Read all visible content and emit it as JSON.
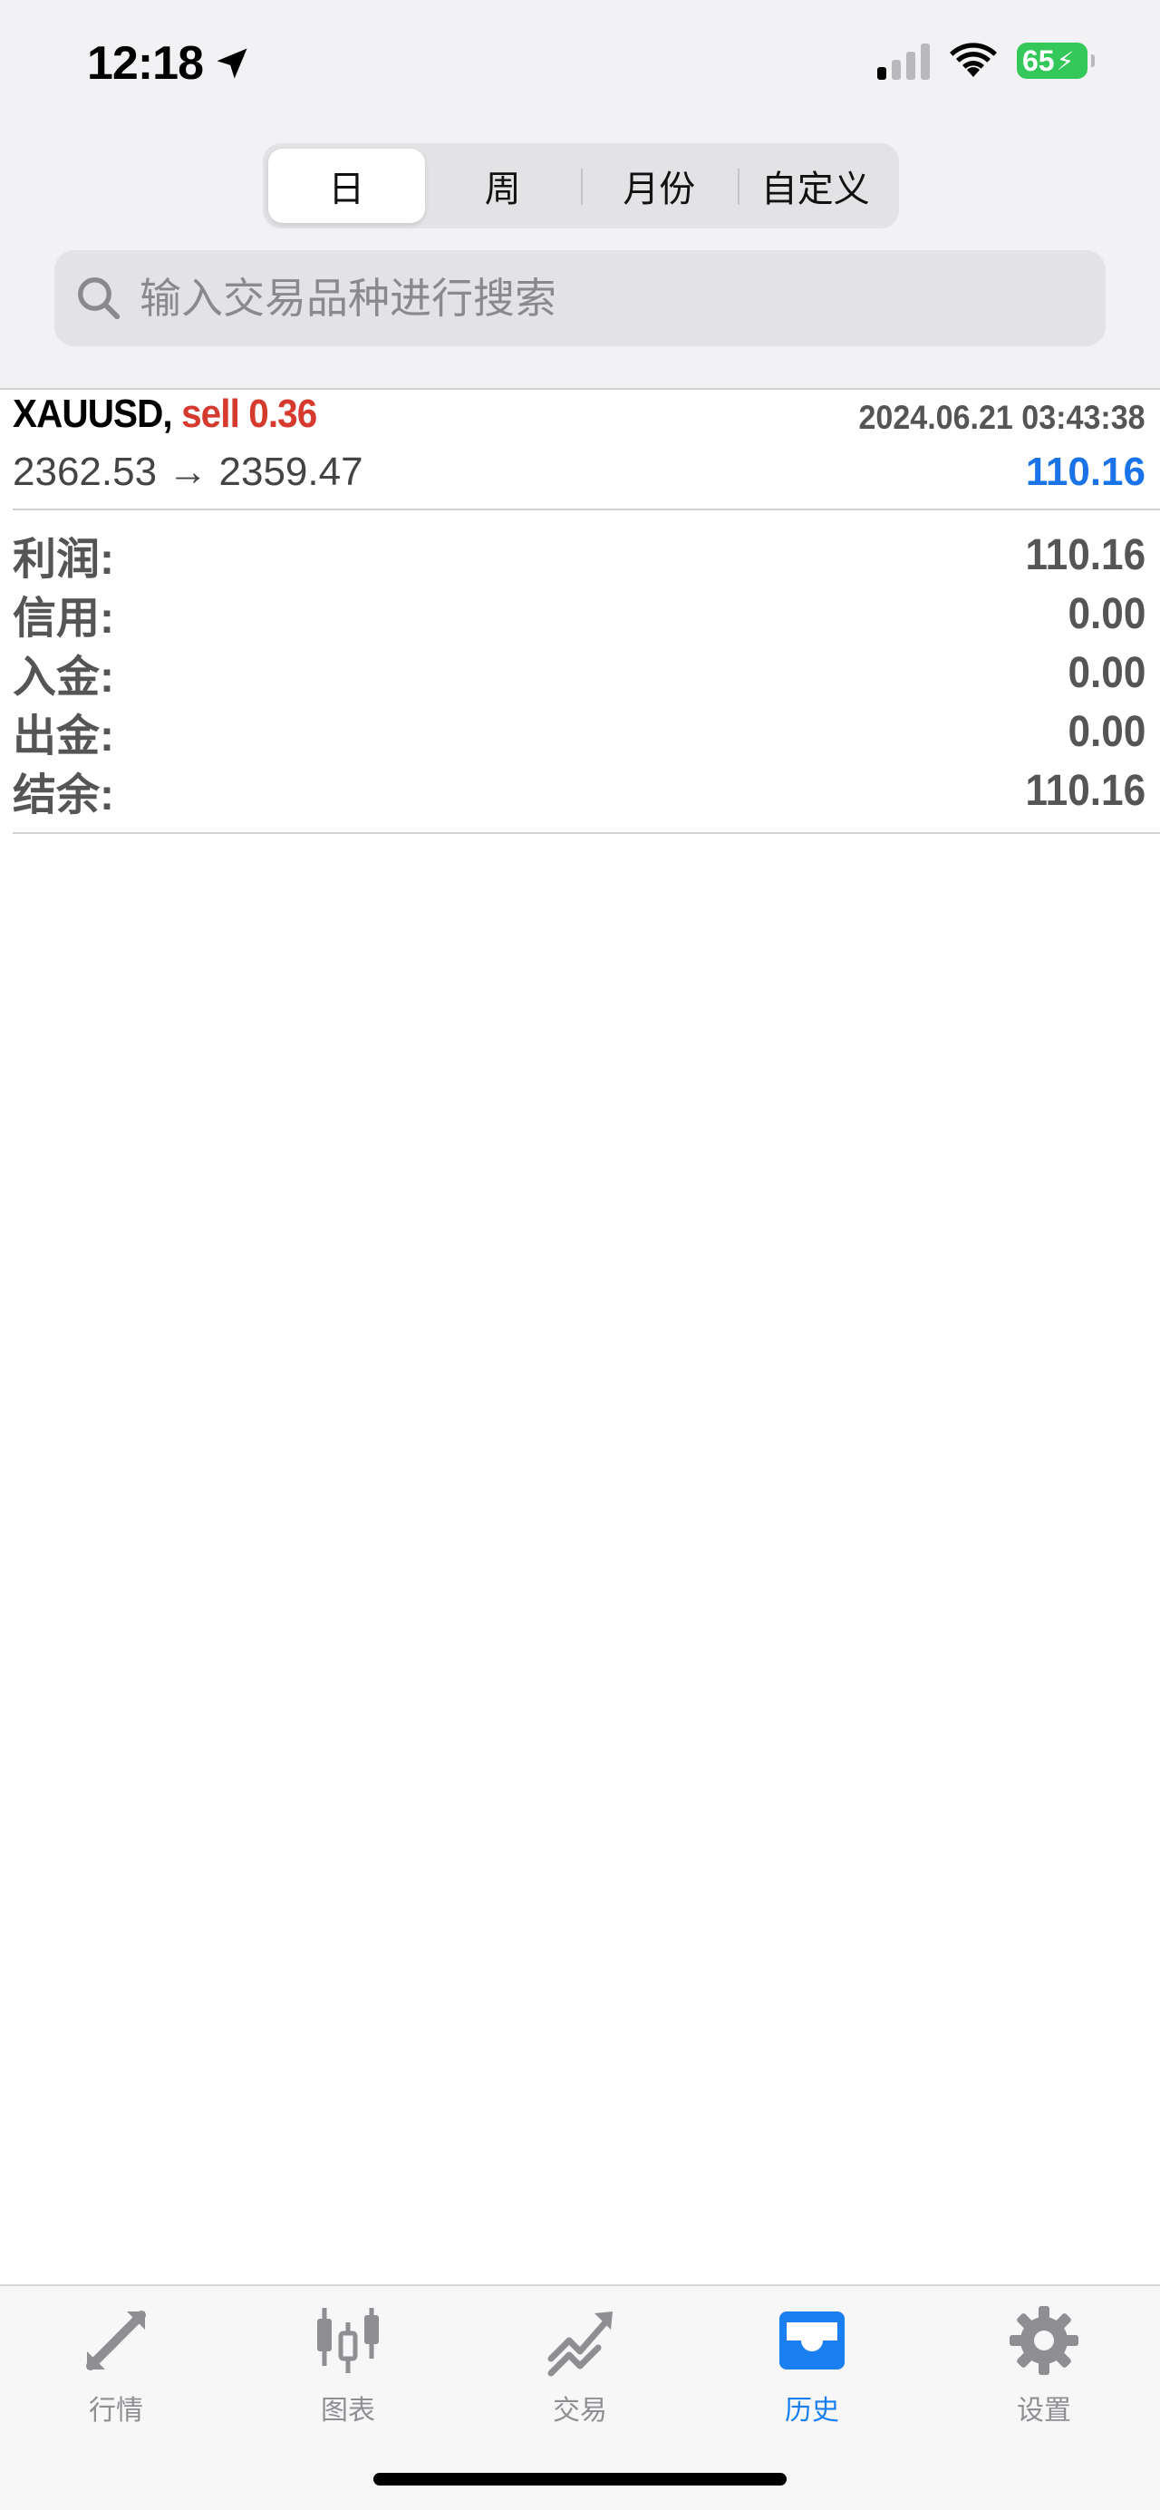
{
  "status_bar": {
    "time": "12:18",
    "battery_percent": "65"
  },
  "period_tabs": {
    "items": [
      {
        "label": "日",
        "active": true
      },
      {
        "label": "周",
        "active": false
      },
      {
        "label": "月份",
        "active": false
      },
      {
        "label": "自定义",
        "active": false
      }
    ]
  },
  "search": {
    "placeholder": "输入交易品种进行搜索",
    "value": ""
  },
  "deal": {
    "symbol": "XAUUSD,",
    "side_volume": "sell 0.36",
    "timestamp": "2024.06.21 03:43:38",
    "prices": "2362.53 → 2359.47",
    "profit": "110.16"
  },
  "summary": [
    {
      "label": "利润:",
      "value": "110.16"
    },
    {
      "label": "信用:",
      "value": "0.00"
    },
    {
      "label": "入金:",
      "value": "0.00"
    },
    {
      "label": "出金:",
      "value": "0.00"
    },
    {
      "label": "结余:",
      "value": "110.16"
    }
  ],
  "tabbar": {
    "items": [
      {
        "label": "行情",
        "icon": "quotes-arrows-icon",
        "active": false
      },
      {
        "label": "图表",
        "icon": "candlestick-chart-icon",
        "active": false
      },
      {
        "label": "交易",
        "icon": "trade-trend-icon",
        "active": false
      },
      {
        "label": "历史",
        "icon": "history-inbox-icon",
        "active": true
      },
      {
        "label": "设置",
        "icon": "gear-icon",
        "active": false
      }
    ]
  },
  "colors": {
    "accent_blue": "#1a7ff0",
    "sell_red": "#d63a2f",
    "battery_green": "#34c759"
  }
}
